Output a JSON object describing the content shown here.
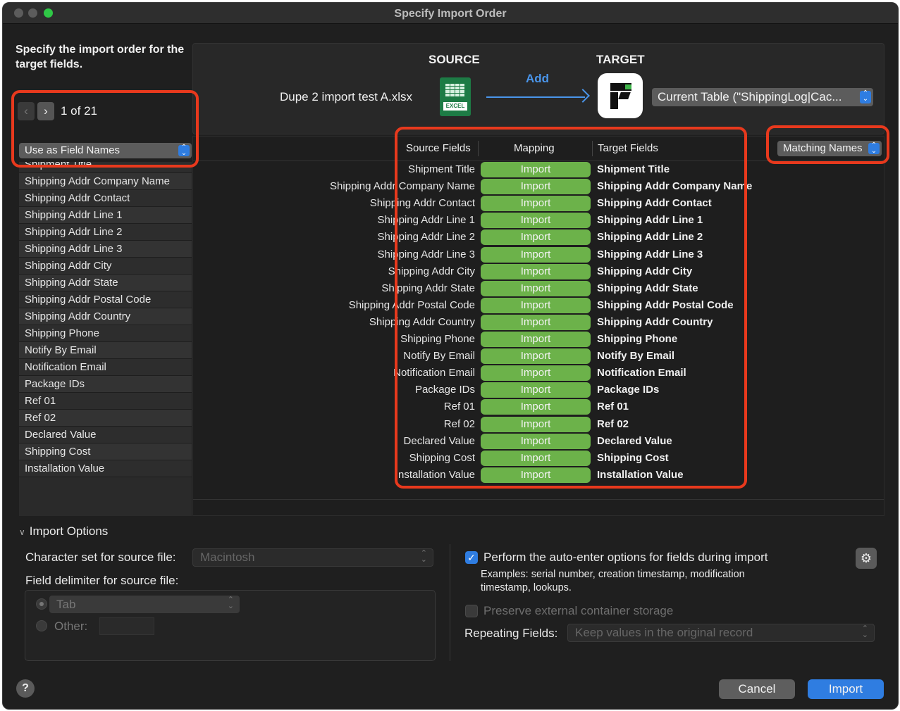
{
  "window": {
    "title": "Specify Import Order"
  },
  "intro": {
    "text": "Specify the import order for the target fields."
  },
  "nav": {
    "counter": "1 of 21",
    "prev_icon": "chevron-left",
    "next_icon": "chevron-right"
  },
  "field_names_popup": {
    "value": "Use as Field Names"
  },
  "header": {
    "source_label": "SOURCE",
    "target_label": "TARGET",
    "add_label": "Add",
    "source_file": "Dupe 2 import test A.xlsx",
    "excel_tag": "EXCEL",
    "target_table": "Current Table (\"ShippingLog|Cac..."
  },
  "columns": {
    "source": "Source Fields",
    "mapping": "Mapping",
    "target": "Target Fields"
  },
  "matching_popup": {
    "value": "Matching Names"
  },
  "left_fields": [
    "Shipment Title",
    "Shipping Addr Company Name",
    "Shipping Addr Contact",
    "Shipping Addr Line 1",
    "Shipping Addr Line 2",
    "Shipping Addr Line 3",
    "Shipping Addr City",
    "Shipping Addr State",
    "Shipping Addr Postal Code",
    "Shipping Addr Country",
    "Shipping Phone",
    "Notify By Email",
    "Notification Email",
    "Package IDs",
    "Ref 01",
    "Ref 02",
    "Declared Value",
    "Shipping Cost",
    "Installation Value"
  ],
  "mapping_rows": [
    {
      "source": "Shipment Title",
      "mapping": "Import",
      "target": "Shipment Title"
    },
    {
      "source": "Shipping Addr Company Name",
      "mapping": "Import",
      "target": "Shipping Addr Company Name"
    },
    {
      "source": "Shipping Addr Contact",
      "mapping": "Import",
      "target": "Shipping Addr Contact"
    },
    {
      "source": "Shipping Addr Line 1",
      "mapping": "Import",
      "target": "Shipping Addr Line 1"
    },
    {
      "source": "Shipping Addr Line 2",
      "mapping": "Import",
      "target": "Shipping Addr Line 2"
    },
    {
      "source": "Shipping Addr Line 3",
      "mapping": "Import",
      "target": "Shipping Addr Line 3"
    },
    {
      "source": "Shipping Addr City",
      "mapping": "Import",
      "target": "Shipping Addr City"
    },
    {
      "source": "Shipping Addr State",
      "mapping": "Import",
      "target": "Shipping Addr State"
    },
    {
      "source": "Shipping Addr Postal Code",
      "mapping": "Import",
      "target": "Shipping Addr Postal Code"
    },
    {
      "source": "Shipping Addr Country",
      "mapping": "Import",
      "target": "Shipping Addr Country"
    },
    {
      "source": "Shipping Phone",
      "mapping": "Import",
      "target": "Shipping Phone"
    },
    {
      "source": "Notify By Email",
      "mapping": "Import",
      "target": "Notify By Email"
    },
    {
      "source": "Notification Email",
      "mapping": "Import",
      "target": "Notification Email"
    },
    {
      "source": "Package IDs",
      "mapping": "Import",
      "target": "Package IDs"
    },
    {
      "source": "Ref 01",
      "mapping": "Import",
      "target": "Ref 01"
    },
    {
      "source": "Ref 02",
      "mapping": "Import",
      "target": "Ref 02"
    },
    {
      "source": "Declared Value",
      "mapping": "Import",
      "target": "Declared Value"
    },
    {
      "source": "Shipping Cost",
      "mapping": "Import",
      "target": "Shipping Cost"
    },
    {
      "source": "Installation Value",
      "mapping": "Import",
      "target": "Installation Value"
    }
  ],
  "import_options": {
    "toggle_label": "Import Options",
    "charset_label": "Character set for source file:",
    "charset_value": "Macintosh",
    "delimiter_label": "Field delimiter for source file:",
    "delimiter_tab": "Tab",
    "delimiter_other": "Other:",
    "auto_enter_label": "Perform the auto-enter options for fields during import",
    "auto_enter_checked": true,
    "auto_enter_examples": "Examples: serial number, creation timestamp, modification timestamp, lookups.",
    "preserve_label": "Preserve external container storage",
    "repeating_label": "Repeating Fields:",
    "repeating_value": "Keep values in the original record"
  },
  "buttons": {
    "help": "?",
    "cancel": "Cancel",
    "import": "Import"
  },
  "colors": {
    "import_pill": "#6cb24a",
    "accent": "#2f7de1",
    "annotation": "#e8391d"
  }
}
